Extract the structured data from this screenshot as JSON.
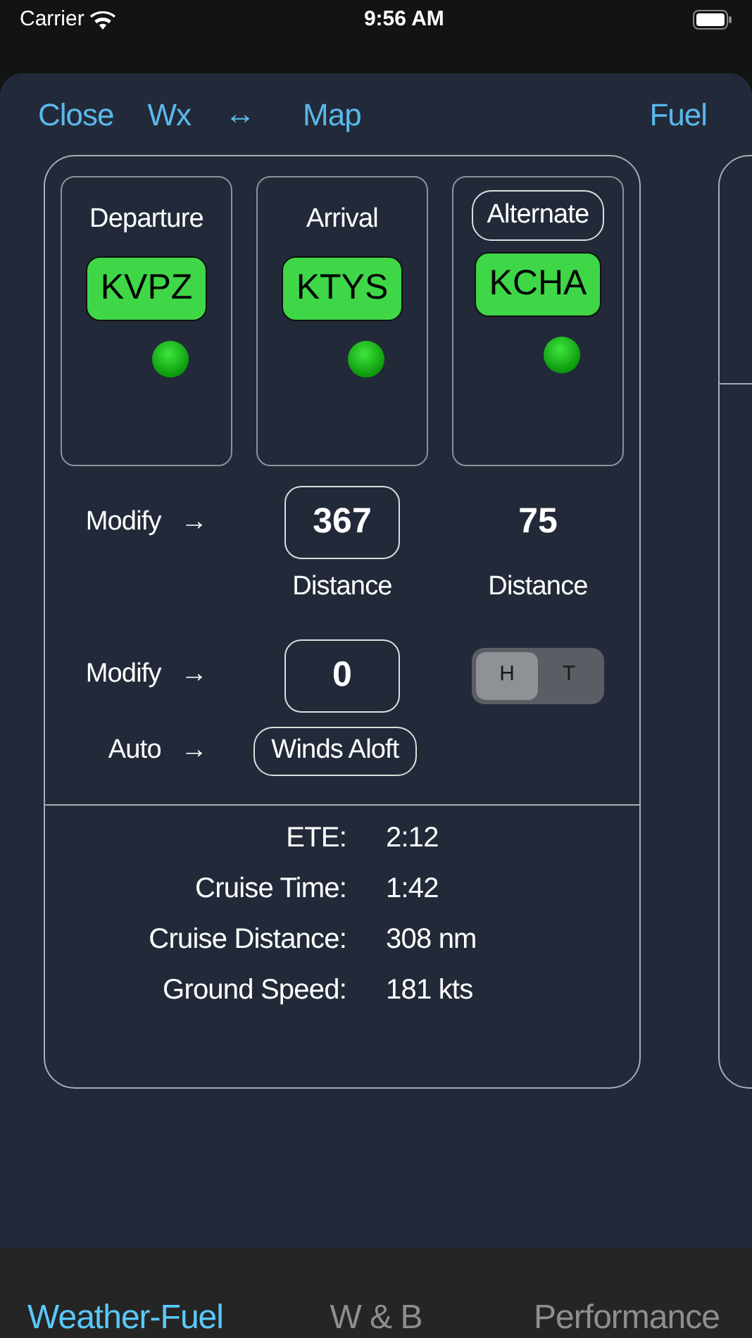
{
  "status_bar": {
    "carrier": "Carrier",
    "time": "9:56 AM"
  },
  "toolbar": {
    "items": [
      {
        "kind": "link",
        "label": "Close"
      },
      {
        "kind": "link",
        "label": "Wx"
      },
      {
        "kind": "swap",
        "label": "↔"
      },
      {
        "kind": "link",
        "label": "Map"
      }
    ],
    "right": "Fuel"
  },
  "airports": [
    {
      "kind": "label",
      "title": "Departure",
      "code": "KVPZ"
    },
    {
      "kind": "label",
      "title": "Arrival",
      "code": "KTYS"
    },
    {
      "kind": "button",
      "title": "Alternate",
      "code": "KCHA"
    }
  ],
  "distance_row": {
    "action": "Modify",
    "arrow": "→",
    "value": "367",
    "value_label": "Distance",
    "alternate_value": "75",
    "alternate_label": "Distance"
  },
  "wind_row": {
    "action": "Modify",
    "arrow": "→",
    "value": "0",
    "toggle": [
      {
        "label": "H",
        "selected": true
      },
      {
        "label": "T",
        "selected": false
      }
    ]
  },
  "auto_row": {
    "action": "Auto",
    "arrow": "→",
    "button": "Winds Aloft"
  },
  "stats": [
    {
      "label": "ETE:",
      "value": "2:12"
    },
    {
      "label": "Cruise Time:",
      "value": "1:42"
    },
    {
      "label": "Cruise Distance:",
      "value": "308 nm"
    },
    {
      "label": "Ground Speed:",
      "value": "181 kts"
    }
  ],
  "tabs": [
    {
      "label": "Weather-Fuel",
      "selected": true
    },
    {
      "label": "W & B",
      "selected": false
    },
    {
      "label": "Performance",
      "selected": false
    }
  ]
}
